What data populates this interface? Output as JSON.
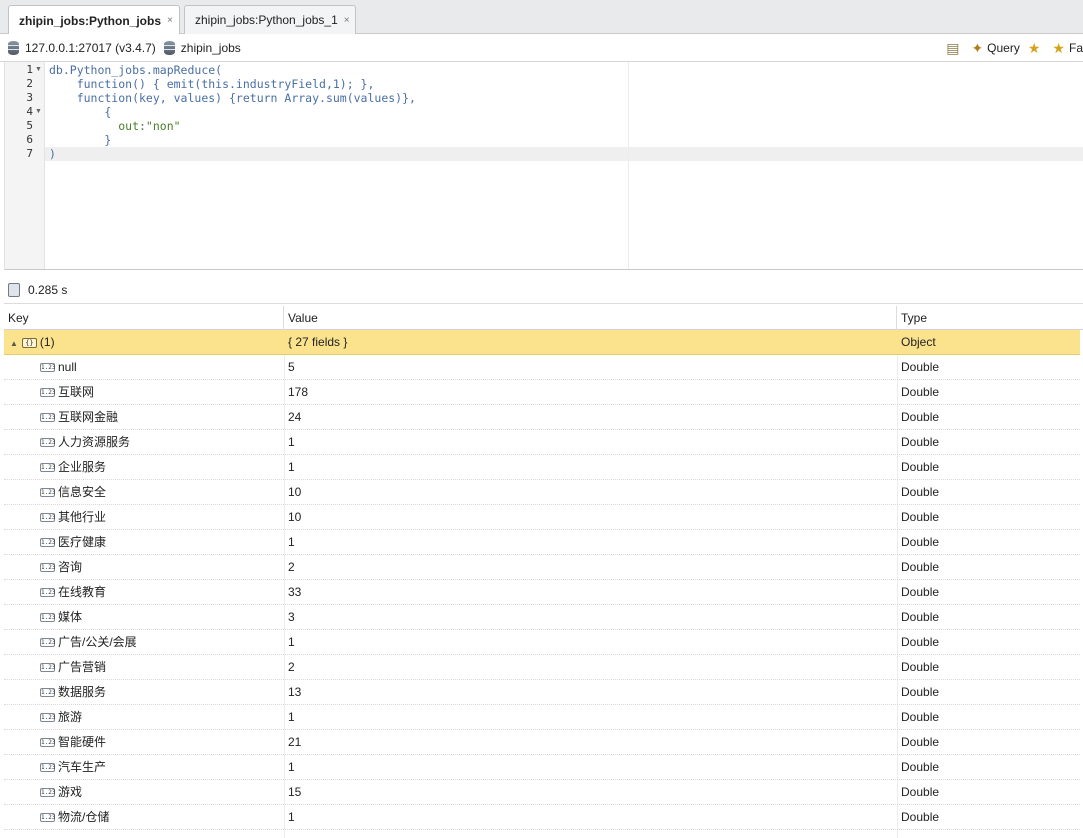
{
  "tabs": [
    {
      "label": "zhipin_jobs:Python_jobs",
      "active": true
    },
    {
      "label": "zhipin_jobs:Python_jobs_1",
      "active": false
    }
  ],
  "tab_close_glyph": "×",
  "toolbar": {
    "server": "127.0.0.1:27017 (v3.4.7)",
    "database": "zhipin_jobs",
    "query_label": "Query",
    "fav_label": "Fa"
  },
  "editor": {
    "lines": [
      {
        "num": "1",
        "fold": true,
        "code": "db.Python_jobs.mapReduce("
      },
      {
        "num": "2",
        "fold": false,
        "code": "    function() { emit(this.industryField,1); },"
      },
      {
        "num": "3",
        "fold": false,
        "code": "    function(key, values) {return Array.sum(values)},"
      },
      {
        "num": "4",
        "fold": true,
        "code": "        {"
      },
      {
        "num": "5",
        "fold": false,
        "code": "          out:\"non\""
      },
      {
        "num": "6",
        "fold": false,
        "code": "        }"
      },
      {
        "num": "7",
        "fold": false,
        "code": ")"
      }
    ]
  },
  "status": {
    "elapsed": "0.285 s"
  },
  "table": {
    "headers": {
      "key": "Key",
      "value": "Value",
      "type": "Type"
    },
    "root": {
      "key": "(1)",
      "value": "{ 27 fields }",
      "type": "Object"
    },
    "rows": [
      {
        "key": "null",
        "value": "5",
        "type": "Double"
      },
      {
        "key": "互联网",
        "value": "178",
        "type": "Double"
      },
      {
        "key": "互联网金融",
        "value": "24",
        "type": "Double"
      },
      {
        "key": "人力资源服务",
        "value": "1",
        "type": "Double"
      },
      {
        "key": "企业服务",
        "value": "1",
        "type": "Double"
      },
      {
        "key": "信息安全",
        "value": "10",
        "type": "Double"
      },
      {
        "key": "其他行业",
        "value": "10",
        "type": "Double"
      },
      {
        "key": "医疗健康",
        "value": "1",
        "type": "Double"
      },
      {
        "key": "咨询",
        "value": "2",
        "type": "Double"
      },
      {
        "key": "在线教育",
        "value": "33",
        "type": "Double"
      },
      {
        "key": "媒体",
        "value": "3",
        "type": "Double"
      },
      {
        "key": "广告/公关/会展",
        "value": "1",
        "type": "Double"
      },
      {
        "key": "广告营销",
        "value": "2",
        "type": "Double"
      },
      {
        "key": "数据服务",
        "value": "13",
        "type": "Double"
      },
      {
        "key": "旅游",
        "value": "1",
        "type": "Double"
      },
      {
        "key": "智能硬件",
        "value": "21",
        "type": "Double"
      },
      {
        "key": "汽车生产",
        "value": "1",
        "type": "Double"
      },
      {
        "key": "游戏",
        "value": "15",
        "type": "Double"
      },
      {
        "key": "物流/仓储",
        "value": "1",
        "type": "Double"
      }
    ]
  },
  "icons": {
    "numeric_field": "1.23",
    "object_field": "{}"
  }
}
